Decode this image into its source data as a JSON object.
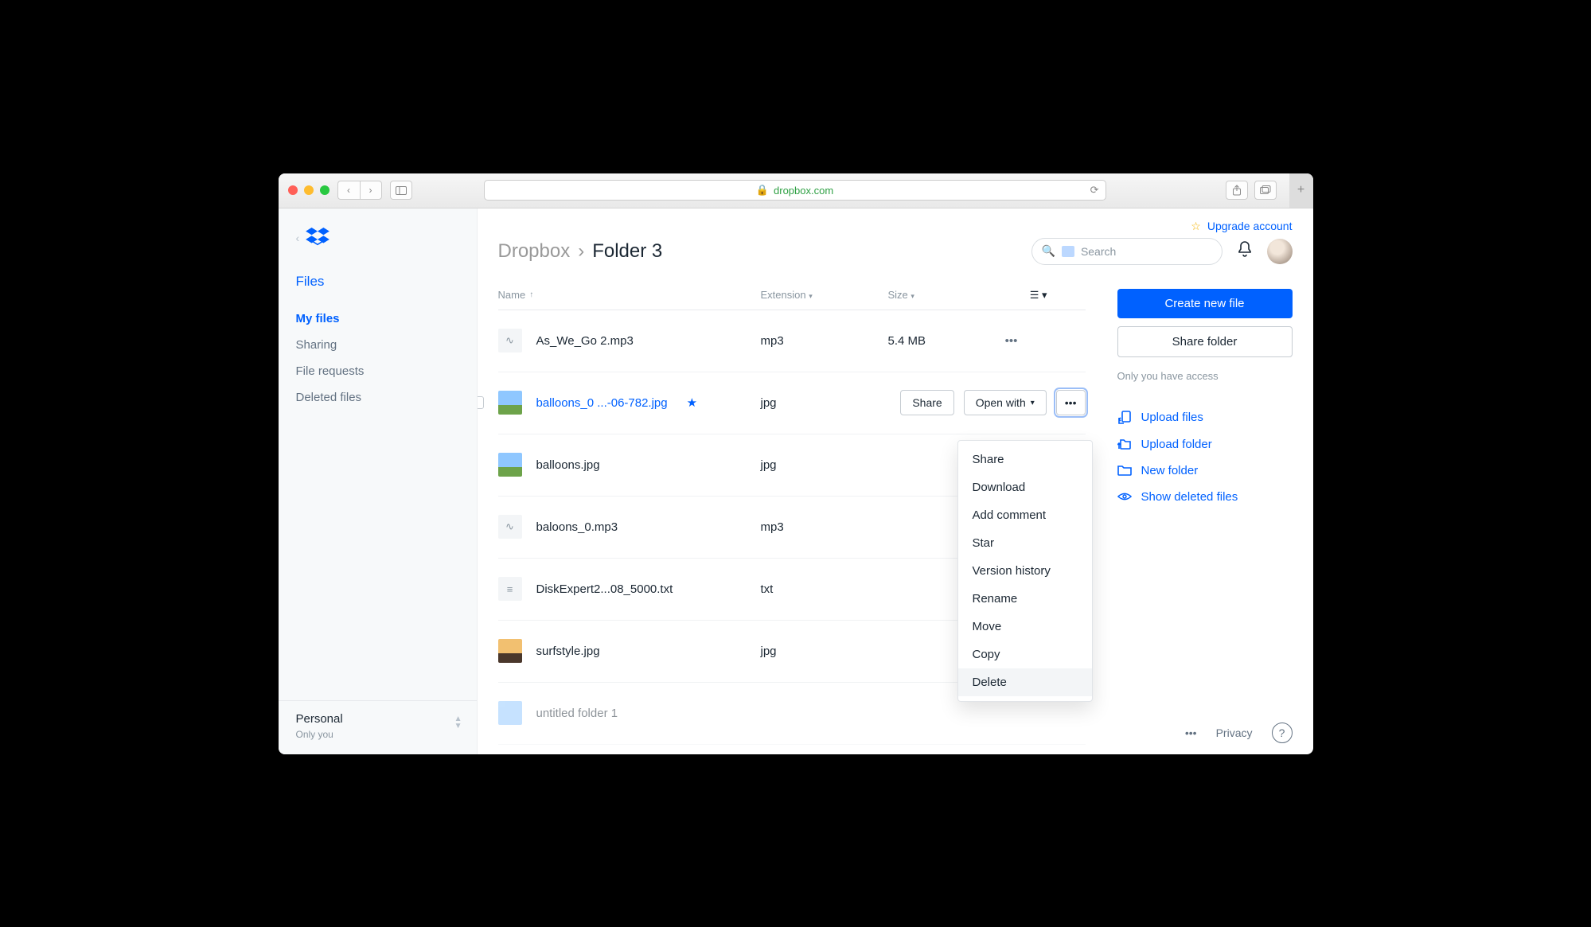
{
  "browser": {
    "url": "dropbox.com"
  },
  "upgrade": {
    "label": "Upgrade account"
  },
  "breadcrumb": {
    "root": "Dropbox",
    "current": "Folder 3"
  },
  "search": {
    "placeholder": "Search"
  },
  "sidebar": {
    "section": "Files",
    "items": [
      {
        "label": "My files",
        "active": true
      },
      {
        "label": "Sharing"
      },
      {
        "label": "File requests"
      },
      {
        "label": "Deleted files"
      }
    ],
    "account": {
      "name": "Personal",
      "sub": "Only you"
    }
  },
  "columns": {
    "name": "Name",
    "ext": "Extension",
    "size": "Size"
  },
  "files": [
    {
      "name": "As_We_Go 2.mp3",
      "ext": "mp3",
      "size": "5.4 MB",
      "kind": "audio"
    },
    {
      "name": "balloons_0 ...-06-782.jpg",
      "ext": "jpg",
      "size": "",
      "kind": "image",
      "selected": true,
      "starred": true
    },
    {
      "name": "balloons.jpg",
      "ext": "jpg",
      "size": "",
      "kind": "image"
    },
    {
      "name": "baloons_0.mp3",
      "ext": "mp3",
      "size": "",
      "kind": "audio"
    },
    {
      "name": "DiskExpert2...08_5000.txt",
      "ext": "txt",
      "size": "",
      "kind": "text"
    },
    {
      "name": "surfstyle.jpg",
      "ext": "jpg",
      "size": "",
      "kind": "image2"
    },
    {
      "name": "untitled folder 1",
      "ext": "",
      "size": "",
      "kind": "folder"
    }
  ],
  "row_actions": {
    "share": "Share",
    "open": "Open with"
  },
  "context_menu": [
    "Share",
    "Download",
    "Add comment",
    "Star",
    "Version history",
    "Rename",
    "Move",
    "Copy",
    "Delete"
  ],
  "right_panel": {
    "create": "Create new file",
    "share_folder": "Share folder",
    "access": "Only you have access",
    "links": [
      {
        "label": "Upload files",
        "icon": "upload-file-icon"
      },
      {
        "label": "Upload folder",
        "icon": "upload-folder-icon"
      },
      {
        "label": "New folder",
        "icon": "folder-icon"
      },
      {
        "label": "Show deleted files",
        "icon": "eye-icon"
      }
    ]
  },
  "footer": {
    "privacy": "Privacy"
  }
}
